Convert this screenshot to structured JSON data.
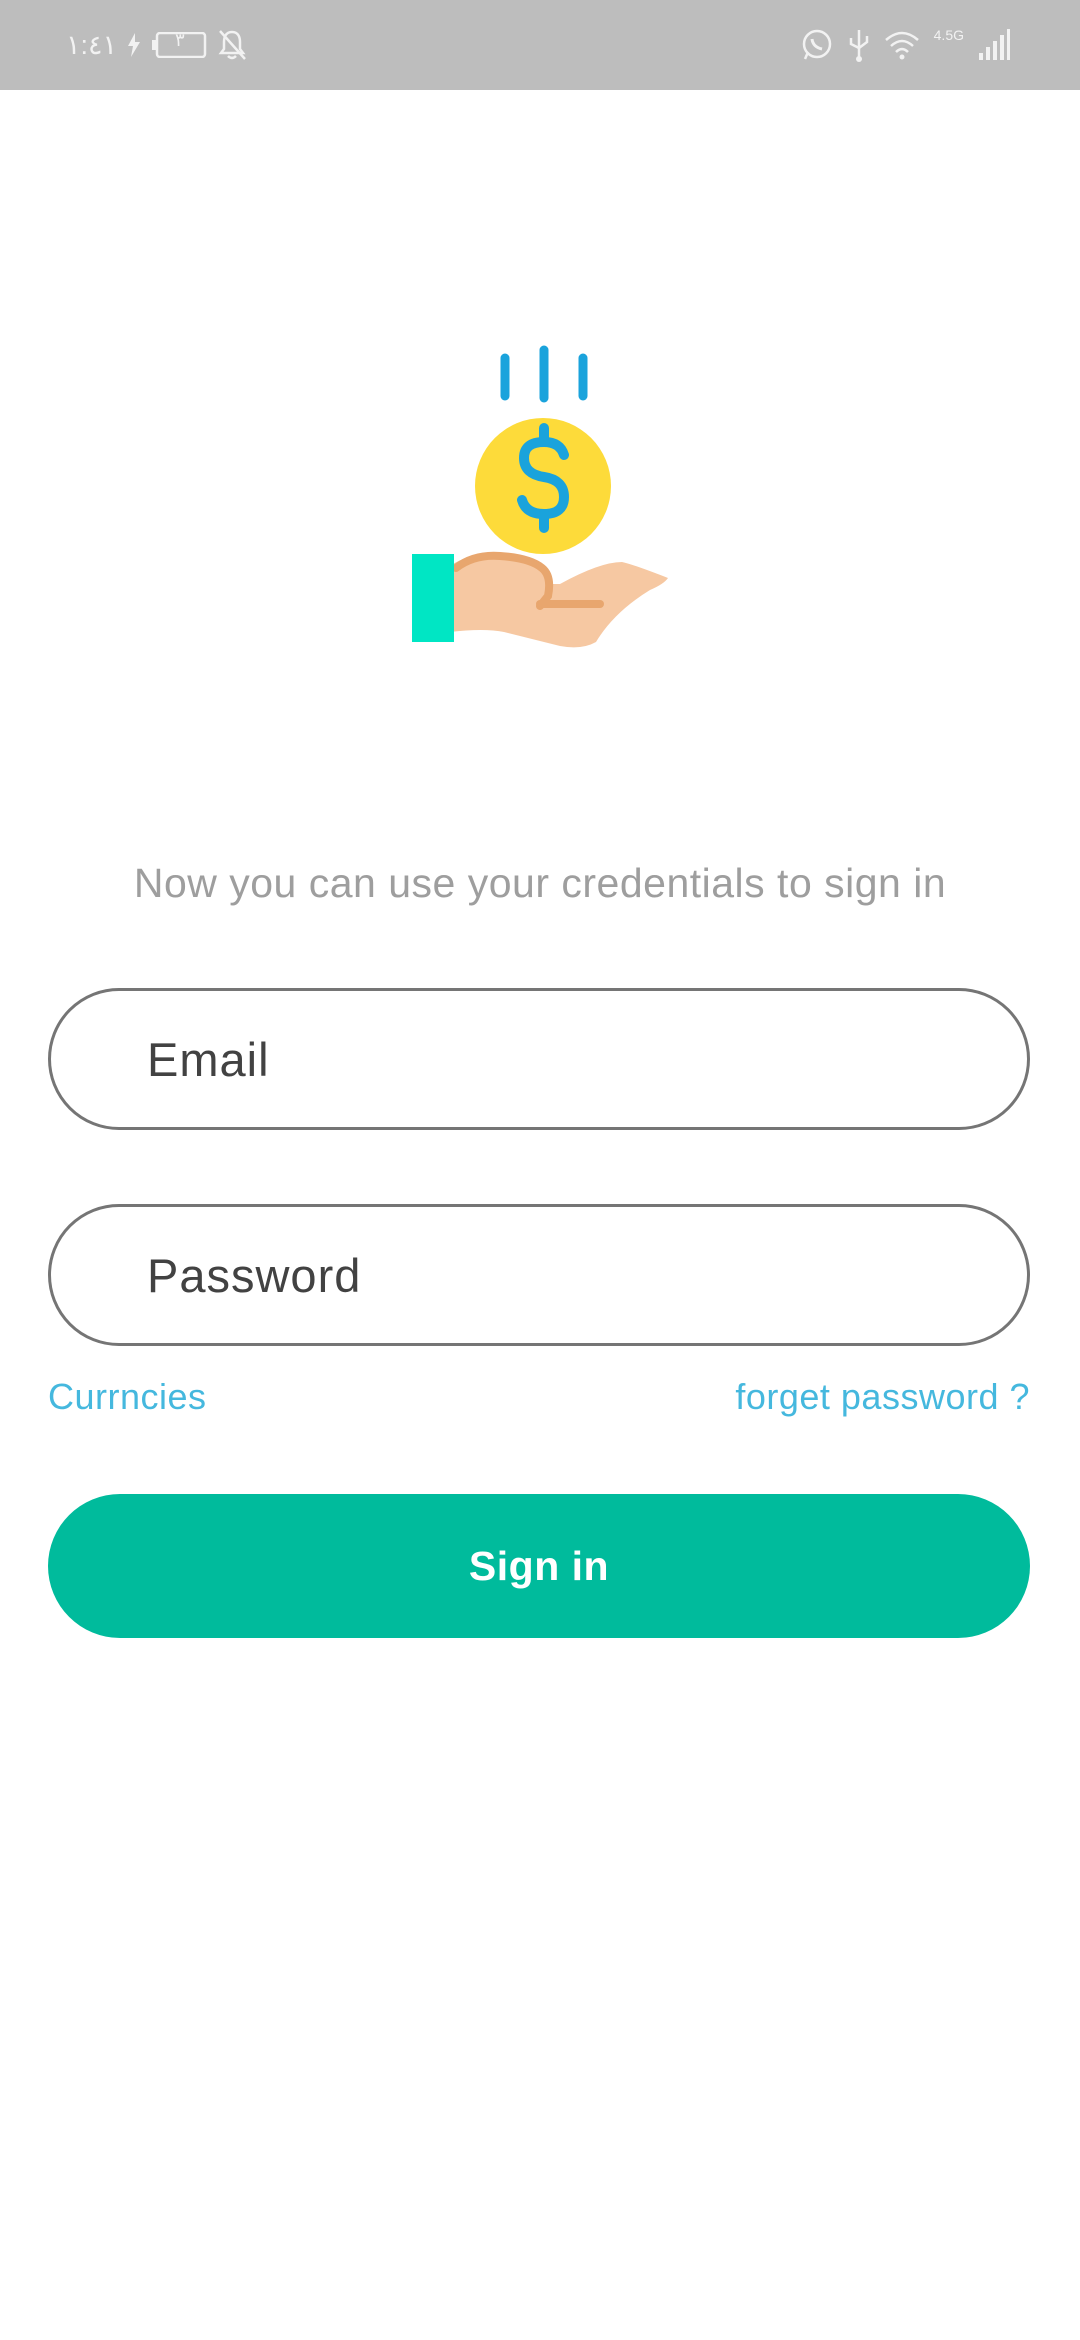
{
  "status_bar": {
    "time": "١:٤١",
    "battery_level": "٣",
    "network_type": "4.5G",
    "icons": [
      "charging-icon",
      "battery-icon",
      "mute-notifications-icon",
      "whatsapp-icon",
      "usb-icon",
      "wifi-icon",
      "signal-icon"
    ]
  },
  "illustration": {
    "icon": "hand-receiving-coin-icon",
    "colors": {
      "coin": "#fddb3a",
      "dollar_sign": "#1aa3dc",
      "hand": "#f6c8a2",
      "sleeve": "#00e6c4"
    }
  },
  "login": {
    "subtitle": "Now you can use your credentials to sign in",
    "email_placeholder": "Email",
    "password_placeholder": "Password",
    "currencies_link": "Currncies",
    "forget_password_link": "forget password ?",
    "sign_in_label": "Sign in"
  },
  "colors": {
    "accent": "#00bb9c",
    "link": "#45b8de",
    "status_bar": "#bdbdbd"
  }
}
